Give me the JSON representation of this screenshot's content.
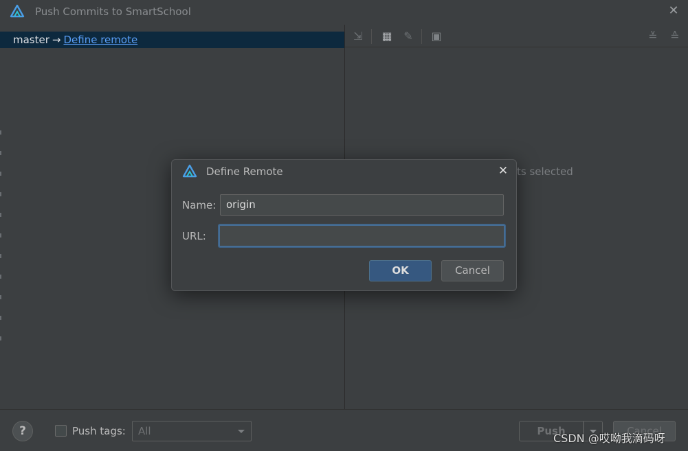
{
  "window": {
    "title": "Push Commits to SmartSchool",
    "app_icon": "app-logo-icon",
    "close_icon": "close-icon"
  },
  "left_panel": {
    "branch": "master",
    "arrow": "→",
    "define_remote_link": "Define remote"
  },
  "right_panel": {
    "toolbar_icons": [
      "collapse-icon",
      "group-icon",
      "edit-icon",
      "diff-icon",
      "expand-all-icon",
      "collapse-all-icon"
    ],
    "empty_text": "ts selected"
  },
  "footer": {
    "help_label": "?",
    "push_tags_label": "Push tags:",
    "tags_select_value": "All",
    "push_label": "Push",
    "cancel_label": "Cancel",
    "watermark": "CSDN @哎呦我滴码呀"
  },
  "dialog": {
    "title": "Define Remote",
    "name_label": "Name:",
    "name_value": "origin",
    "url_label": "URL:",
    "url_value": "",
    "ok_label": "OK",
    "cancel_label": "Cancel"
  },
  "colors": {
    "background": "#3c3f41",
    "selection": "#0d293e",
    "link": "#589df6",
    "ok_button": "#365880",
    "focus_border": "#466d94"
  }
}
